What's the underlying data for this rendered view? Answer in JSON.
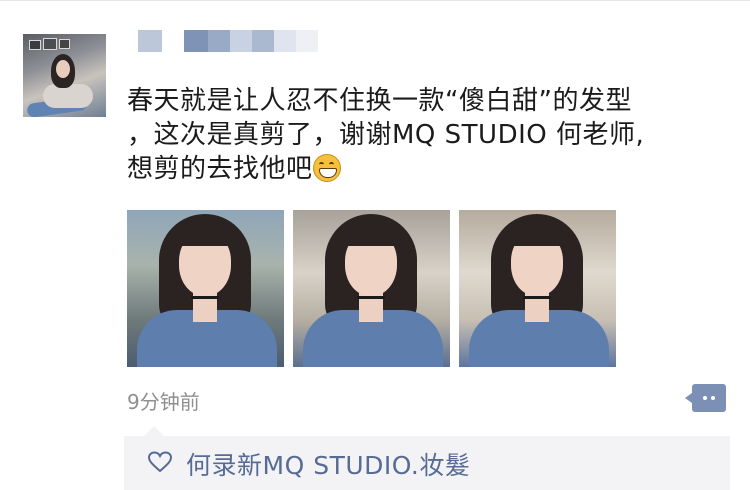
{
  "post": {
    "author_name": "",
    "text_lines": [
      "春天就是让人忍不住换一款“傻白甜”的发型",
      "，这次是真剪了，谢谢MQ STUDIO 何老师,",
      "想剪的去找他吧"
    ],
    "emoji": "grinning-face-emoji",
    "photos": [
      {
        "name": "photo-1"
      },
      {
        "name": "photo-2"
      },
      {
        "name": "photo-3"
      }
    ],
    "time": "9分钟前"
  },
  "likes": {
    "names": "何录新MQ STUDIO.妆髮"
  },
  "colors": {
    "link_blue": "#576b95",
    "comment_button": "#7c8fb4",
    "likes_bg": "#f3f3f5",
    "meta_gray": "#8f8f8f"
  },
  "icons": {
    "comment": "comment-bubble-icon",
    "like": "heart-outline-icon"
  }
}
